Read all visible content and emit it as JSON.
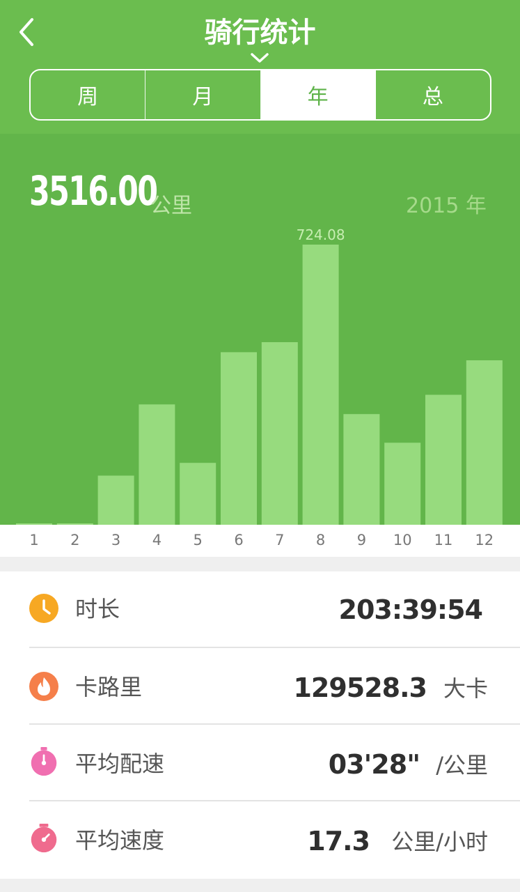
{
  "header": {
    "title": "骑行统计",
    "back_icon": "chevron-left-icon",
    "tabs": [
      {
        "label": "周",
        "active": false
      },
      {
        "label": "月",
        "active": false
      },
      {
        "label": "年",
        "active": true
      },
      {
        "label": "总",
        "active": false
      }
    ]
  },
  "summary": {
    "total": "3516.00",
    "unit": "公里",
    "year": "2015 年"
  },
  "chart_data": {
    "type": "bar",
    "categories": [
      "1",
      "2",
      "3",
      "4",
      "5",
      "6",
      "7",
      "8",
      "9",
      "10",
      "11",
      "12"
    ],
    "values": [
      2,
      2,
      127,
      311,
      160,
      446,
      472,
      724.08,
      286,
      212,
      336,
      425
    ],
    "data_labels": [
      {
        "category": "8",
        "text": "724.08"
      }
    ],
    "ylim": [
      0,
      724.08
    ],
    "title": "",
    "xlabel": "",
    "ylabel": "",
    "colors": {
      "background": "#62b54a",
      "bar": "#97db7e",
      "label": "#c7eeb2",
      "axis_text": "#777777"
    }
  },
  "stats": [
    {
      "icon": "clock-icon",
      "color": "#f7a823",
      "label": "时长",
      "value": "203:39:54",
      "unit": ""
    },
    {
      "icon": "flame-icon",
      "color": "#f57f4a",
      "label": "卡路里",
      "value": "129528.3",
      "unit": "大卡"
    },
    {
      "icon": "stopwatch-icon",
      "color": "#f06fb0",
      "label": "平均配速",
      "value": "03'28\"",
      "unit": "/公里"
    },
    {
      "icon": "timer-icon",
      "color": "#ef6b8e",
      "label": "平均速度",
      "value": "17.3",
      "unit": "公里/小时"
    }
  ]
}
